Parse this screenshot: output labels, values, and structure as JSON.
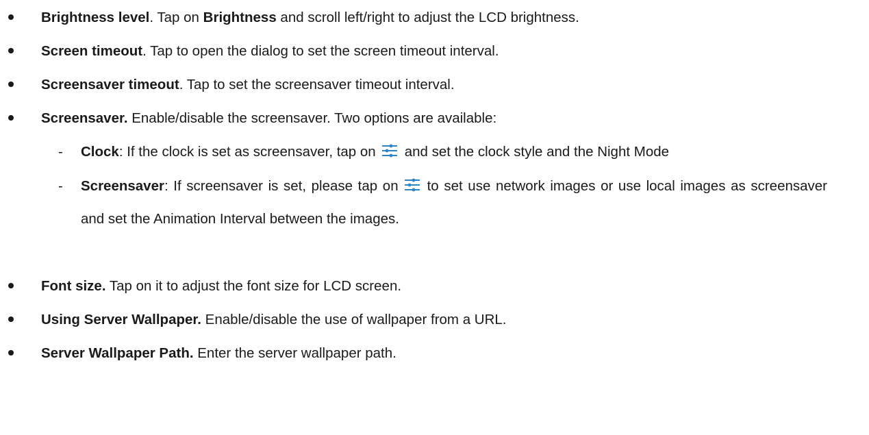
{
  "items": [
    {
      "title": "Brightness level",
      "sep": ".",
      "text_a": " Tap on ",
      "bold_b": "Brightness",
      "text_b": " and scroll left/right to adjust the LCD brightness."
    },
    {
      "title": "Screen timeout",
      "sep": ".",
      "text": " Tap to open the dialog to set the screen timeout interval."
    },
    {
      "title": "Screensaver timeout",
      "sep": ".",
      "text": " Tap to set the screensaver timeout interval."
    },
    {
      "title": "Screensaver.",
      "text": " Enable/disable the screensaver. Two options are available:"
    },
    {
      "title": "Font size.",
      "text": " Tap on it to adjust the font size for LCD screen."
    },
    {
      "title": "Using Server Wallpaper.",
      "text": " Enable/disable the use of wallpaper from a URL."
    },
    {
      "title": "Server Wallpaper Path.",
      "text": " Enter the server wallpaper path."
    }
  ],
  "subitems": [
    {
      "dash": "-",
      "title": "Clock",
      "text_before": ": If the clock is set as screensaver, tap on",
      "text_after": "and set the clock style and the Night Mode",
      "icon": "settings-sliders-icon"
    },
    {
      "dash": "-",
      "title": "Screensaver",
      "text_before": ": If screensaver is set, please tap on",
      "text_after": "to set use network images or use local images as screensaver and set the Animation Interval between the images.",
      "icon": "settings-sliders-icon"
    }
  ],
  "colors": {
    "text": "#1a1a1a",
    "icon": "#2a86c8"
  }
}
